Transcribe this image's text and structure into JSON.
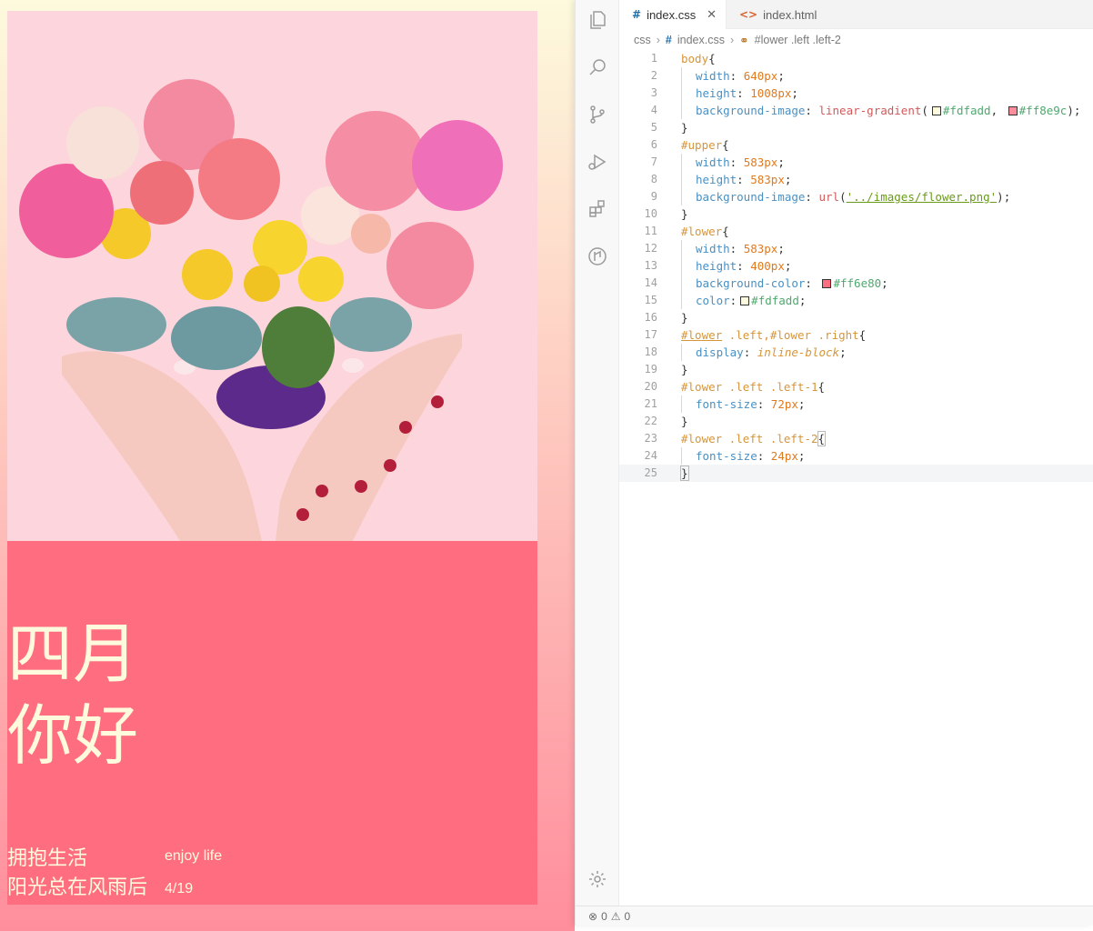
{
  "preview": {
    "image": {
      "description": "heart-shaped flower bouquet held in two hands"
    },
    "title_line1": "四月",
    "title_line2": "你好",
    "sub_line1": "拥抱生活",
    "sub_line2": "阳光总在风雨后",
    "right_line1": "enjoy life",
    "right_line2": "4/19",
    "colors": {
      "gradient_top": "#fdfadd",
      "gradient_bottom": "#ff8e9c",
      "lower_bg": "#ff6e80",
      "text": "#fdfadd"
    }
  },
  "editor": {
    "activity_icons": [
      "files-icon",
      "search-icon",
      "source-control-icon",
      "run-debug-icon",
      "extensions-icon",
      "remote-icon",
      "gear-icon"
    ],
    "tabs": [
      {
        "label": "index.css",
        "icon": "#",
        "active": true
      },
      {
        "label": "index.html",
        "icon": "<>",
        "active": false
      }
    ],
    "breadcrumb": {
      "folder": "css",
      "file": "index.css",
      "symbol": "#lower .left .left-2"
    },
    "line_numbers": [
      "1",
      "2",
      "3",
      "4",
      "5",
      "6",
      "7",
      "8",
      "9",
      "10",
      "11",
      "12",
      "13",
      "14",
      "15",
      "16",
      "17",
      "18",
      "19",
      "20",
      "21",
      "22",
      "23",
      "24",
      "25"
    ],
    "code": {
      "l1_sel": "body",
      "l2_prop": "width",
      "l2_val": "640px",
      "l3_prop": "height",
      "l3_val": "1008px",
      "l4_prop": "background-image",
      "l4_fn": "linear-gradient",
      "l4_c1": "#fdfadd",
      "l4_c2": "#ff8e9c",
      "l6_sel": "#upper",
      "l7_prop": "width",
      "l7_val": "583px",
      "l8_prop": "height",
      "l8_val": "583px",
      "l9_prop": "background-image",
      "l9_fn": "url",
      "l9_str": "'../images/flower.png'",
      "l11_sel": "#lower",
      "l12_prop": "width",
      "l12_val": "583px",
      "l13_prop": "height",
      "l13_val": "400px",
      "l14_prop": "background-color",
      "l14_val": "#ff6e80",
      "l15_prop": "color",
      "l15_val": "#fdfadd",
      "l17_a": "#lower",
      "l17_b": " .left,#lower .right",
      "l18_prop": "display",
      "l18_val": "inline-block",
      "l20_sel": "#lower .left .left-1",
      "l21_prop": "font-size",
      "l21_val": "72px",
      "l23_sel": "#lower .left .left-2",
      "l24_prop": "font-size",
      "l24_val": "24px"
    },
    "status": {
      "errors": "0",
      "warnings": "0"
    }
  }
}
